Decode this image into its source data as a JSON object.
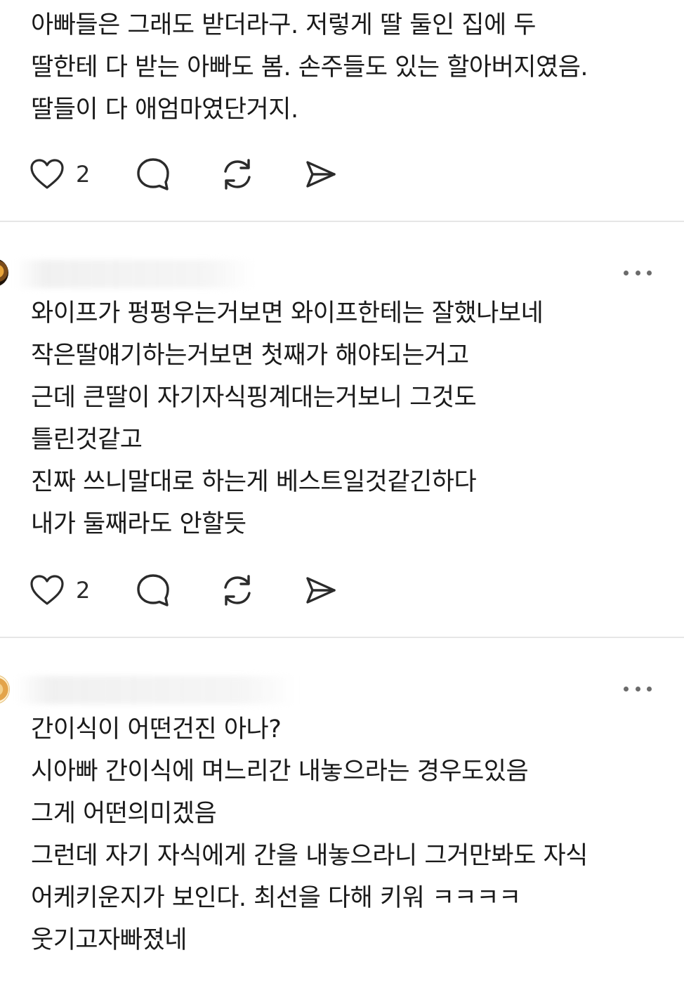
{
  "posts": [
    {
      "lines": [
        "아빠들은 그래도 받더라구. 저렇게 딸 둘인 집에 두",
        "딸한테 다 받는 아빠도 봄. 손주들도 있는 할아버지였음.",
        "딸들이 다 애엄마였단거지."
      ],
      "like_count": "2"
    },
    {
      "lines": [
        "와이프가 펑펑우는거보면 와이프한테는 잘했나보네",
        "작은딸얘기하는거보면 첫째가 해야되는거고",
        "근데 큰딸이 자기자식핑계대는거보니 그것도",
        "틀린것같고",
        "진짜 쓰니말대로 하는게 베스트일것같긴하다",
        "내가 둘째라도 안할듯"
      ],
      "like_count": "2"
    },
    {
      "lines": [
        "간이식이 어떤건진 아나?",
        "시아빠 간이식에 며느리간 내놓으라는 경우도있음",
        "그게 어떤의미겠음",
        "그런데 자기 자식에게 간을 내놓으라니 그거만봐도 자식",
        "어케키운지가 보인다. 최선을 다해 키워 ㅋㅋㅋㅋ",
        "웃기고자빠졌네"
      ]
    }
  ],
  "icons": {
    "like": "heart-icon",
    "reply": "comment-bubble-icon",
    "repost": "repost-icon",
    "share": "send-icon",
    "more": "more-dots-icon"
  },
  "colors": {
    "text": "#1a1a1a",
    "icon": "#2b2b2b",
    "divider": "#e6e6e6"
  }
}
